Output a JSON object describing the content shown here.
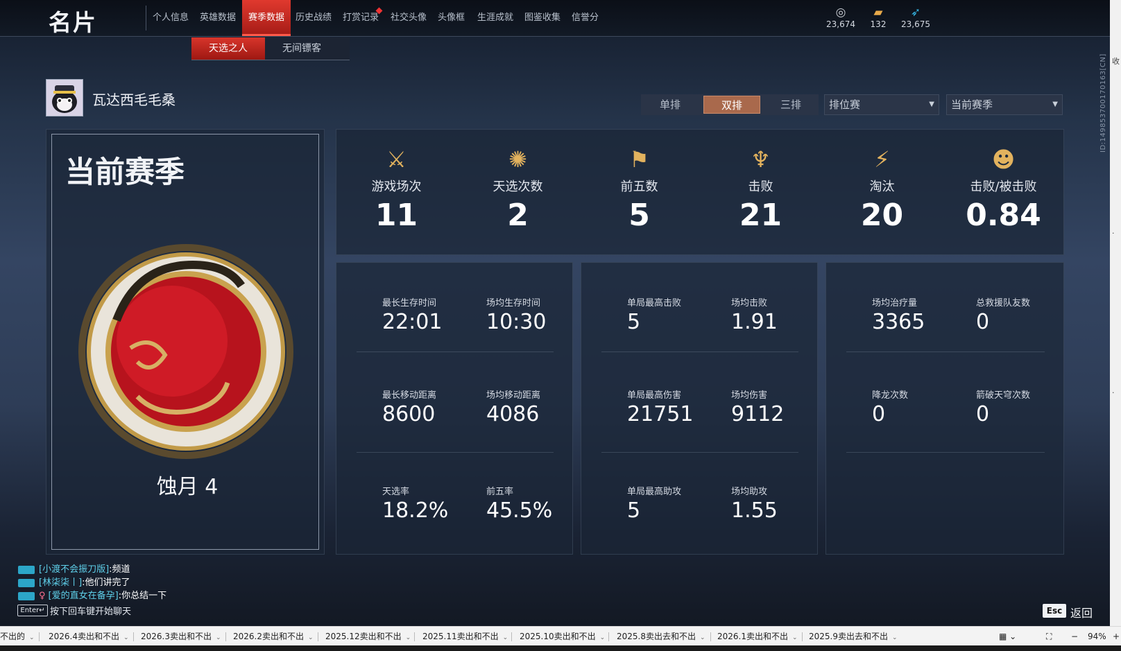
{
  "header": {
    "title": "名片",
    "nav_tabs": [
      "个人信息",
      "英雄数据",
      "赛季数据",
      "历史战绩",
      "打赏记录",
      "社交头像",
      "头像框",
      "生涯成就",
      "图鉴收集",
      "信誉分"
    ],
    "active_tab": "赛季数据",
    "currencies": [
      {
        "icon": "coin-stack-icon",
        "value": "23,674"
      },
      {
        "icon": "ticket-icon",
        "value": "132"
      },
      {
        "icon": "feather-icon",
        "value": "23,675"
      }
    ]
  },
  "sub_tabs": [
    "天选之人",
    "无间镖客"
  ],
  "active_sub_tab": "天选之人",
  "side_id": "ID:1498537001701​63[CN]",
  "user": {
    "name": "瓦达西毛毛桑"
  },
  "filters": {
    "modes": [
      "单排",
      "双排",
      "三排"
    ],
    "active_mode": "双排",
    "match_type": "排位赛",
    "season": "当前赛季"
  },
  "season_card": {
    "label": "当前赛季",
    "rank": "蚀月 4"
  },
  "summary_stats": [
    {
      "icon": "crossed-swords-icon",
      "label": "游戏场次",
      "value": "11"
    },
    {
      "icon": "lotus-emblem-icon",
      "label": "天选次数",
      "value": "2"
    },
    {
      "icon": "banner-icon",
      "label": "前五数",
      "value": "5"
    },
    {
      "icon": "trident-icon",
      "label": "击败",
      "value": "21"
    },
    {
      "icon": "broken-blade-icon",
      "label": "淘汰",
      "value": "20"
    },
    {
      "icon": "mask-icon",
      "label": "击败/被击败",
      "value": "0.84"
    }
  ],
  "detail_groups": [
    {
      "rows": [
        [
          {
            "label": "最长生存时间",
            "value": "22:01"
          },
          {
            "label": "场均生存时间",
            "value": "10:30"
          }
        ],
        [
          {
            "label": "最长移动距离",
            "value": "8600"
          },
          {
            "label": "场均移动距离",
            "value": "4086"
          }
        ],
        [
          {
            "label": "天选率",
            "value": "18.2%"
          },
          {
            "label": "前五率",
            "value": "45.5%"
          }
        ]
      ]
    },
    {
      "rows": [
        [
          {
            "label": "单局最高击败",
            "value": "5"
          },
          {
            "label": "场均击败",
            "value": "1.91"
          }
        ],
        [
          {
            "label": "单局最高伤害",
            "value": "21751"
          },
          {
            "label": "场均伤害",
            "value": "9112"
          }
        ],
        [
          {
            "label": "单局最高助攻",
            "value": "5"
          },
          {
            "label": "场均助攻",
            "value": "1.55"
          }
        ]
      ]
    },
    {
      "rows": [
        [
          {
            "label": "场均治疗量",
            "value": "3365"
          },
          {
            "label": "总救援队友数",
            "value": "0"
          }
        ],
        [
          {
            "label": "降龙次数",
            "value": "0"
          },
          {
            "label": "箭破天穹次数",
            "value": "0"
          }
        ]
      ]
    }
  ],
  "chat": [
    {
      "name": "[小渡不会振刀版]",
      "text": ":频道"
    },
    {
      "name": "[林柒柒丨]",
      "text": ":他们讲完了"
    },
    {
      "name": "[爱的直女在备孕]",
      "text": ":你总结一下"
    }
  ],
  "chat_hint": {
    "key": "Enter↵",
    "text": "按下回车键开始聊天"
  },
  "back": {
    "key": "Esc",
    "label": "返回"
  },
  "bookmarks": [
    "不出的",
    "2026.4卖出和不出",
    "2026.3卖出和不出",
    "2026.2卖出和不出",
    "2025.12卖出和不出",
    "2025.11卖出和不出",
    "2025.10卖出和不出",
    "2025.8卖出去和不出",
    "2026.1卖出和不出",
    "2025.9卖出去和不出"
  ],
  "browser": {
    "zoom": "94%"
  }
}
